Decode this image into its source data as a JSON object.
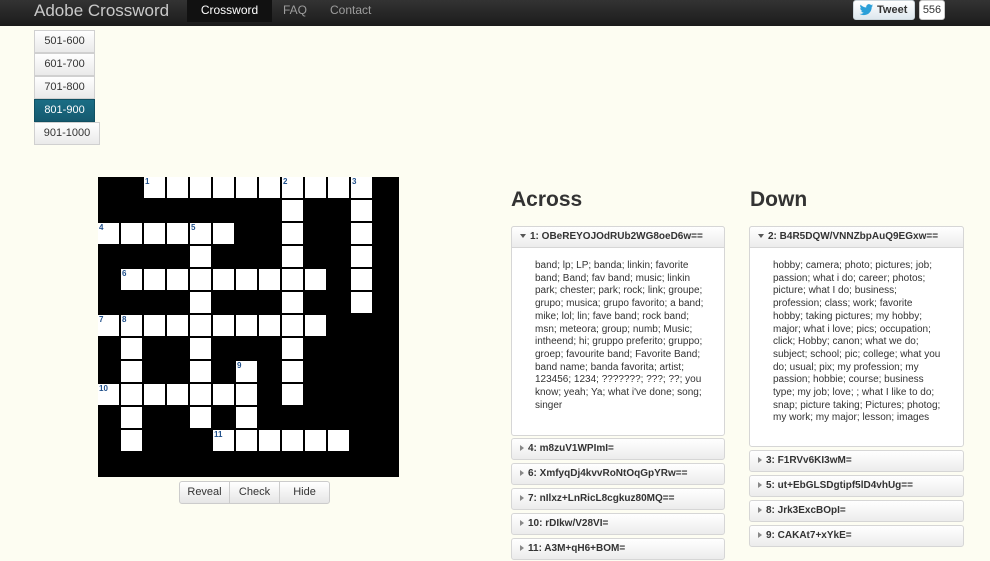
{
  "navbar": {
    "brand": "Adobe Crossword",
    "items": [
      "Crossword",
      "FAQ",
      "Contact"
    ],
    "active": "Crossword",
    "tweet_label": "Tweet",
    "tweet_count": "556"
  },
  "ranges": {
    "items": [
      "501-600",
      "601-700",
      "701-800",
      "801-900",
      "901-1000"
    ],
    "active": "801-900"
  },
  "grid": {
    "numbers": [
      "1",
      "2",
      "3",
      "4",
      "5",
      "6",
      "7",
      "8",
      "9",
      "10",
      "11"
    ]
  },
  "controls": [
    "Reveal",
    "Check",
    "Hide"
  ],
  "across": {
    "title": "Across",
    "expanded_head": "1: OBeREYOJOdRUb2WG8oeD6w==",
    "expanded_text": "band; lp; LP; banda; linkin; favorite band; Band; fav band; music; linkin park; chester; park; rock; link; groupe; grupo; musica; grupo favorito; a band; mike; lol; lin; fave band; rock band; msn; meteora; group; numb; Music; intheend; hi; gruppo preferito; gruppo; groep; favourite band; Favorite Band; band name; banda favorita; artist; 123456; 1234; ???????; ???; ??; you know; yeah; Ya; what i've done; song; singer",
    "collapsed": [
      "4: m8zuV1WPImI=",
      "6: XmfyqDj4kvvRoNtOqGpYRw==",
      "7: nIlxz+LnRicL8cgkuz80MQ==",
      "10: rDIkw/V28VI=",
      "11: A3M+qH6+BOM="
    ]
  },
  "down": {
    "title": "Down",
    "expanded_head": "2: B4R5DQW/VNNZbpAuQ9EGxw==",
    "expanded_text": "hobby; camera; photo; pictures; job; passion; what i do; career; photos; picture; what I do; business; profession; class; work; favorite hobby; taking pictures; my hobby; major; what i love; pics; occupation; click; Hobby; canon; what we do; subject; school; pic; college; what you do; usual; pix; my profession; my passion; hobbie; course; business type; my job; love; ; what I like to do; snap; picture taking; Pictures; photog; my work; my major; lesson; images",
    "collapsed": [
      "3: F1RVv6KI3wM=",
      "5: ut+EbGLSDgtipf5lD4vhUg==",
      "8: Jrk3ExcBOpI=",
      "9: CAKAt7+xYkE="
    ]
  }
}
